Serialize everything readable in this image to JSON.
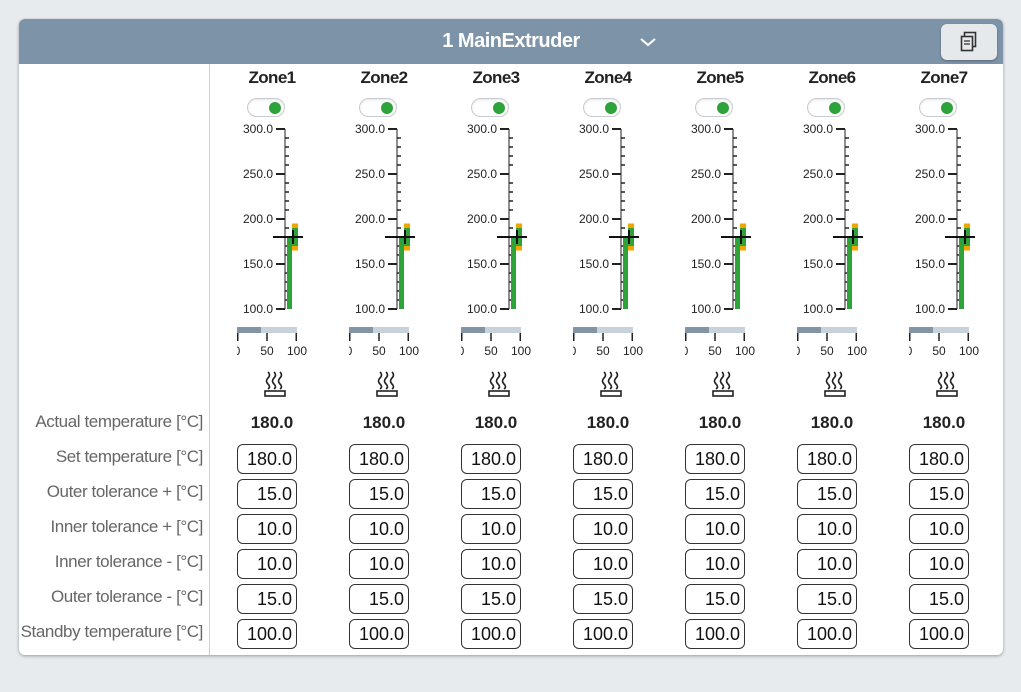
{
  "header": {
    "title": "1 MainExtruder",
    "chevron_icon": "chevron-down-icon",
    "copy_icon": "clipboard-copy-icon"
  },
  "row_labels": [
    "Actual temperature [°C]",
    "Set temperature [°C]",
    "Outer tolerance + [°C]",
    "Inner tolerance + [°C]",
    "Inner tolerance - [°C]",
    "Outer tolerance - [°C]",
    "Standby temperature [°C]"
  ],
  "gauge": {
    "scale_labels": [
      "300.0",
      "250.0",
      "200.0",
      "150.0",
      "100.0"
    ],
    "scale_min": 100,
    "scale_max": 300,
    "power_labels": [
      "0",
      "50",
      "100"
    ],
    "colors": {
      "in_tolerance": "#2ea33a",
      "outer_band": "#f0a500",
      "power_fill": "#8394a6",
      "power_track": "#c9d2db"
    }
  },
  "zones": [
    {
      "name": "Zone1",
      "enabled": true,
      "power": 40,
      "actual": "180.0",
      "set": "180.0",
      "outer_plus": "15.0",
      "inner_plus": "10.0",
      "inner_minus": "10.0",
      "outer_minus": "15.0",
      "standby": "100.0"
    },
    {
      "name": "Zone2",
      "enabled": true,
      "power": 40,
      "actual": "180.0",
      "set": "180.0",
      "outer_plus": "15.0",
      "inner_plus": "10.0",
      "inner_minus": "10.0",
      "outer_minus": "15.0",
      "standby": "100.0"
    },
    {
      "name": "Zone3",
      "enabled": true,
      "power": 40,
      "actual": "180.0",
      "set": "180.0",
      "outer_plus": "15.0",
      "inner_plus": "10.0",
      "inner_minus": "10.0",
      "outer_minus": "15.0",
      "standby": "100.0"
    },
    {
      "name": "Zone4",
      "enabled": true,
      "power": 40,
      "actual": "180.0",
      "set": "180.0",
      "outer_plus": "15.0",
      "inner_plus": "10.0",
      "inner_minus": "10.0",
      "outer_minus": "15.0",
      "standby": "100.0"
    },
    {
      "name": "Zone5",
      "enabled": true,
      "power": 40,
      "actual": "180.0",
      "set": "180.0",
      "outer_plus": "15.0",
      "inner_plus": "10.0",
      "inner_minus": "10.0",
      "outer_minus": "15.0",
      "standby": "100.0"
    },
    {
      "name": "Zone6",
      "enabled": true,
      "power": 40,
      "actual": "180.0",
      "set": "180.0",
      "outer_plus": "15.0",
      "inner_plus": "10.0",
      "inner_minus": "10.0",
      "outer_minus": "15.0",
      "standby": "100.0"
    },
    {
      "name": "Zone7",
      "enabled": true,
      "power": 40,
      "actual": "180.0",
      "set": "180.0",
      "outer_plus": "15.0",
      "inner_plus": "10.0",
      "inner_minus": "10.0",
      "outer_minus": "15.0",
      "standby": "100.0"
    }
  ]
}
